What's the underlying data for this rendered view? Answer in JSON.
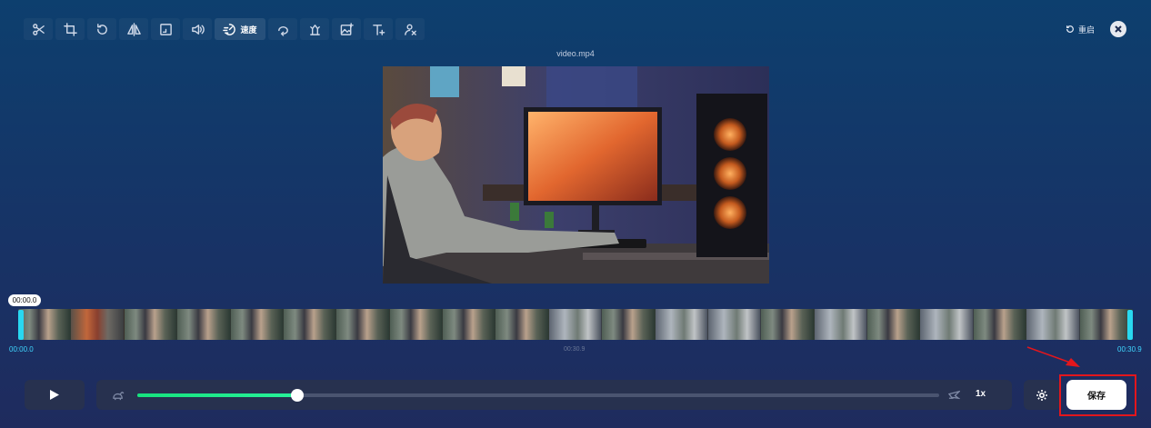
{
  "toolbar": {
    "tools": [
      {
        "icon": "scissors-icon"
      },
      {
        "icon": "crop-icon"
      },
      {
        "icon": "rotate-icon"
      },
      {
        "icon": "flip-icon"
      },
      {
        "icon": "resize-icon"
      },
      {
        "icon": "volume-icon"
      },
      {
        "icon": "speed-icon",
        "label": "速度",
        "active": true
      },
      {
        "icon": "loop-icon"
      },
      {
        "icon": "stabilize-icon"
      },
      {
        "icon": "add-image-icon"
      },
      {
        "icon": "add-text-icon"
      },
      {
        "icon": "remove-watermark-icon"
      }
    ]
  },
  "header": {
    "restart_label": "重启",
    "filename": "video.mp4"
  },
  "timeline": {
    "current_time": "00:00.0",
    "start_time": "00:00.0",
    "mid_time": "00:30.9",
    "end_time": "00:30.9",
    "frame_count": 21
  },
  "controls": {
    "speed_value": "1x",
    "speed_position": 0.2,
    "save_label": "保存"
  },
  "colors": {
    "accent_green": "#1fe68c",
    "handle_cyan": "#29d8f0",
    "highlight_red": "#e3161c"
  }
}
